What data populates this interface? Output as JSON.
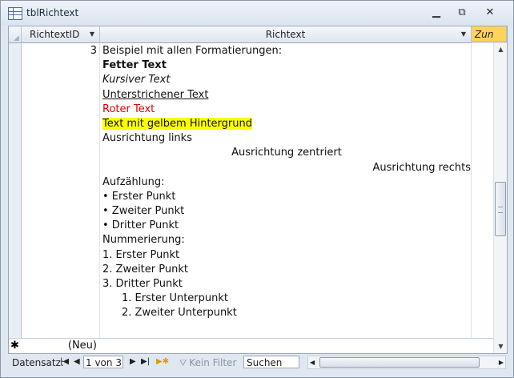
{
  "window": {
    "title": "tblRichtext",
    "icon": "table-icon"
  },
  "columns": {
    "id": "RichtextID",
    "richtext": "Richtext",
    "zusatz": "Zun"
  },
  "record": {
    "id": "3",
    "lines": [
      "Beispiel mit allen Formatierungen:",
      "Fetter Text",
      "Kursiver Text",
      "Unterstrichener Text",
      "Roter Text",
      "Text mit gelbem Hintergrund",
      "Ausrichtung links",
      "Ausrichtung zentriert",
      "Ausrichtung rechts",
      "Aufzählung:",
      "• Erster Punkt",
      "• Zweiter Punkt",
      "• Dritter Punkt",
      "Nummerierung:",
      "1. Erster Punkt",
      "2. Zweiter Punkt",
      "3. Dritter Punkt",
      "1. Erster Unterpunkt",
      "2. Zweiter Unterpunkt"
    ]
  },
  "new_row": {
    "marker": "✱",
    "label": "(Neu)"
  },
  "navigation": {
    "label": "Datensatz:",
    "position": "1 von 3",
    "filter": "Kein Filter",
    "search": "Suchen"
  },
  "colors": {
    "header_accent": "#ffd35a",
    "red_text": "#e00000",
    "highlight": "#ffff00"
  }
}
